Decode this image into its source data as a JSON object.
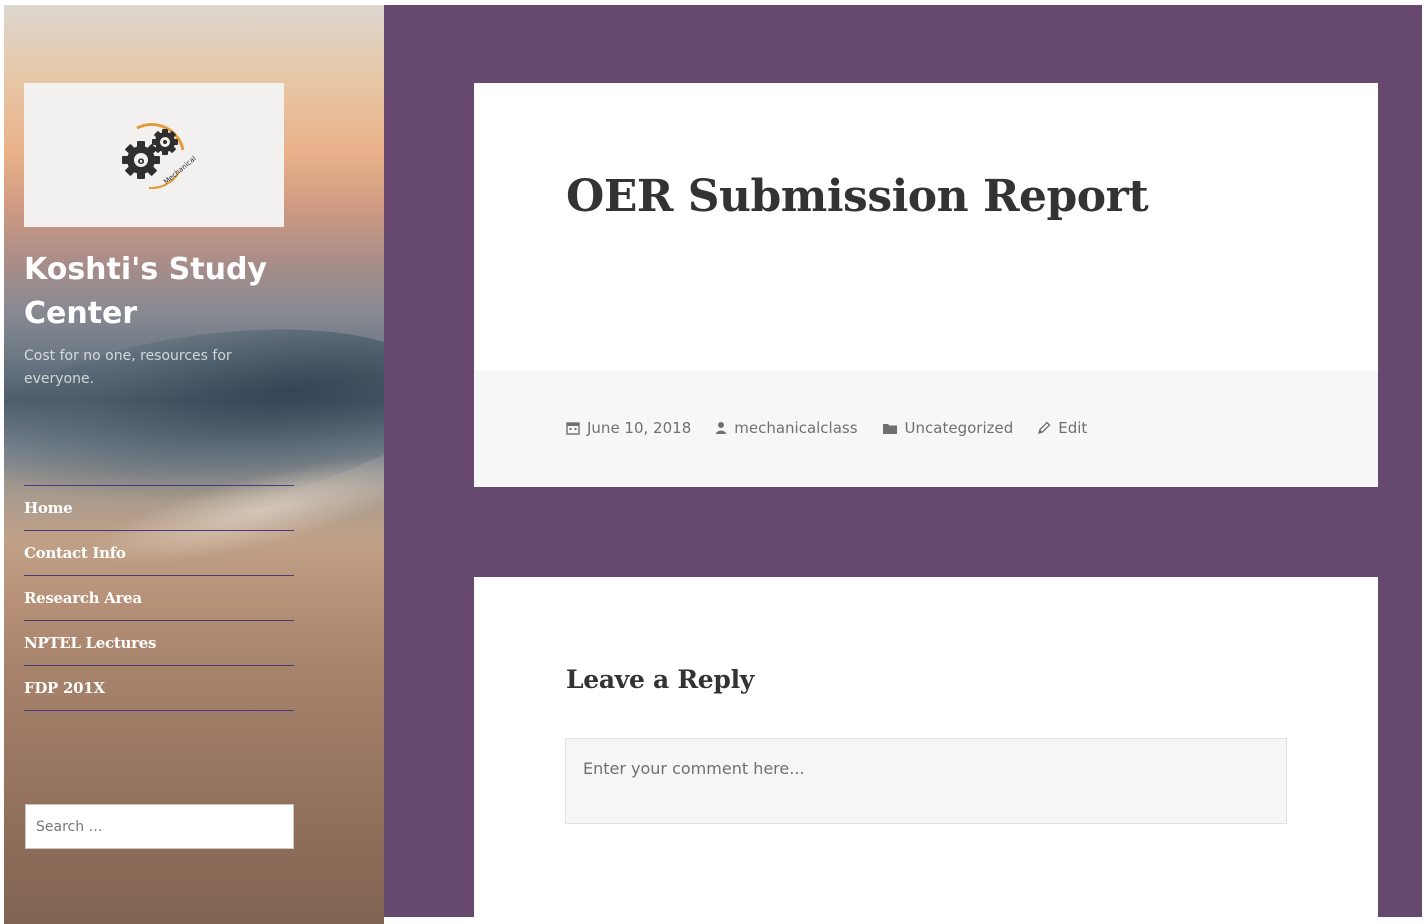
{
  "site": {
    "title": "Koshti's Study Center",
    "description": "Cost for no one, resources for everyone.",
    "logo_text": "Mechanical"
  },
  "nav": {
    "items": [
      {
        "label": "Home"
      },
      {
        "label": "Contact Info"
      },
      {
        "label": "Research Area"
      },
      {
        "label": "NPTEL Lectures"
      },
      {
        "label": "FDP 201X"
      }
    ]
  },
  "search": {
    "placeholder": "Search …"
  },
  "post": {
    "title": "OER Submission Report",
    "meta": {
      "date": "June 10, 2018",
      "author": "mechanicalclass",
      "category": "Uncategorized",
      "edit_label": "Edit"
    }
  },
  "comments": {
    "title": "Leave a Reply",
    "placeholder": "Enter your comment here..."
  },
  "colors": {
    "main_background": "#67496f",
    "card_background": "#ffffff",
    "nav_divider": "#4a3a7a"
  },
  "icons": {
    "logo": "gears-icon",
    "date": "calendar-icon",
    "author": "user-icon",
    "category": "folder-icon",
    "edit": "pencil-icon"
  }
}
